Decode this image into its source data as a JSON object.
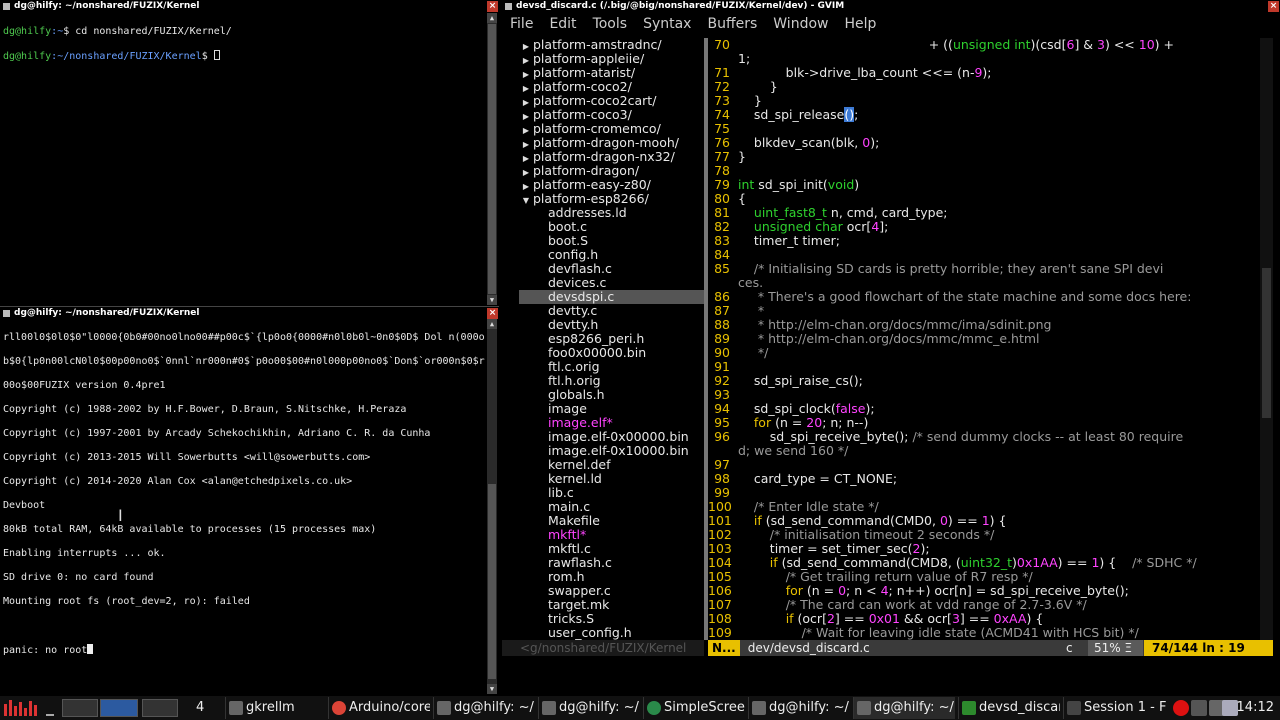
{
  "term1": {
    "title": "dg@hilfy: ~/nonshared/FUZIX/Kernel",
    "lines": [
      {
        "user": "dg@hilfy",
        "path": ":~",
        "cmd": "$ cd nonshared/FUZIX/Kernel/"
      },
      {
        "user": "dg@hilfy",
        "path": ":~/nonshared/FUZIX/Kernel",
        "cmd": "$ "
      }
    ]
  },
  "term2": {
    "title": "dg@hilfy: ~/nonshared/FUZIX/Kernel",
    "lines": [
      "rll00l0$0l0$0\"l0000{0b0#00no0lno00##p00c$`{lp0o0{0000#n0l0b0l~0n0$0D$ Dol n(000o",
      "b$0{lp0n00lcN0l0$00p00no0$`0nnl`nr000n#0$`p0o00$00#n0l000p00no0$`Don$`or000n$0$r",
      "00o$00FUZIX version 0.4pre1",
      "Copyright (c) 1988-2002 by H.F.Bower, D.Braun, S.Nitschke, H.Peraza",
      "Copyright (c) 1997-2001 by Arcady Schekochikhin, Adriano C. R. da Cunha",
      "Copyright (c) 2013-2015 Will Sowerbutts <will@sowerbutts.com>",
      "Copyright (c) 2014-2020 Alan Cox <alan@etchedpixels.co.uk>",
      "Devboot",
      "80kB total RAM, 64kB available to processes (15 processes max)",
      "Enabling interrupts ... ok.",
      "SD drive 0: no card found",
      "Mounting root fs (root_dev=2, ro): failed",
      "",
      "panic: no root"
    ]
  },
  "gvim": {
    "title": "devsd_discard.c (/.big/@big/nonshared/FUZIX/Kernel/dev) - GVIM",
    "menu": [
      "File",
      "Edit",
      "Tools",
      "Syntax",
      "Buffers",
      "Window",
      "Help"
    ],
    "tree": [
      {
        "kind": "dir",
        "arrow": "▶",
        "name": "platform-amstradnc/"
      },
      {
        "kind": "dir",
        "arrow": "▶",
        "name": "platform-appleiie/"
      },
      {
        "kind": "dir",
        "arrow": "▶",
        "name": "platform-atarist/"
      },
      {
        "kind": "dir",
        "arrow": "▶",
        "name": "platform-coco2/"
      },
      {
        "kind": "dir",
        "arrow": "▶",
        "name": "platform-coco2cart/"
      },
      {
        "kind": "dir",
        "arrow": "▶",
        "name": "platform-coco3/"
      },
      {
        "kind": "dir",
        "arrow": "▶",
        "name": "platform-cromemco/"
      },
      {
        "kind": "dir",
        "arrow": "▶",
        "name": "platform-dragon-mooh/"
      },
      {
        "kind": "dir",
        "arrow": "▶",
        "name": "platform-dragon-nx32/"
      },
      {
        "kind": "dir",
        "arrow": "▶",
        "name": "platform-dragon/"
      },
      {
        "kind": "dir",
        "arrow": "▶",
        "name": "platform-easy-z80/"
      },
      {
        "kind": "dir",
        "arrow": "▼",
        "name": "platform-esp8266/"
      },
      {
        "kind": "file",
        "name": "addresses.ld"
      },
      {
        "kind": "file",
        "name": "boot.c"
      },
      {
        "kind": "file",
        "name": "boot.S"
      },
      {
        "kind": "file",
        "name": "config.h"
      },
      {
        "kind": "file",
        "name": "devflash.c"
      },
      {
        "kind": "file",
        "name": "devices.c"
      },
      {
        "kind": "file",
        "name": "devsdspi.c",
        "sel": true
      },
      {
        "kind": "file",
        "name": "devtty.c"
      },
      {
        "kind": "file",
        "name": "devtty.h"
      },
      {
        "kind": "file",
        "name": "esp8266_peri.h"
      },
      {
        "kind": "file",
        "name": "foo0x00000.bin"
      },
      {
        "kind": "file",
        "name": "ftl.c.orig"
      },
      {
        "kind": "file",
        "name": "ftl.h.orig"
      },
      {
        "kind": "file",
        "name": "globals.h"
      },
      {
        "kind": "file",
        "name": "image"
      },
      {
        "kind": "file",
        "name": "image.elf*",
        "exe": true
      },
      {
        "kind": "file",
        "name": "image.elf-0x00000.bin"
      },
      {
        "kind": "file",
        "name": "image.elf-0x10000.bin"
      },
      {
        "kind": "file",
        "name": "kernel.def"
      },
      {
        "kind": "file",
        "name": "kernel.ld"
      },
      {
        "kind": "file",
        "name": "lib.c"
      },
      {
        "kind": "file",
        "name": "main.c"
      },
      {
        "kind": "file",
        "name": "Makefile"
      },
      {
        "kind": "file",
        "name": "mkftl*",
        "exe": true
      },
      {
        "kind": "file",
        "name": "mkftl.c"
      },
      {
        "kind": "file",
        "name": "rawflash.c"
      },
      {
        "kind": "file",
        "name": "rom.h"
      },
      {
        "kind": "file",
        "name": "swapper.c"
      },
      {
        "kind": "file",
        "name": "target.mk"
      },
      {
        "kind": "file",
        "name": "tricks.S"
      },
      {
        "kind": "file",
        "name": "user_config.h"
      }
    ],
    "code": [
      {
        "ln": "70",
        "html": "                                                + ((<span class=\"ty\">unsigned int</span>)(csd[<span class=\"num\">6</span>] & <span class=\"num\">3</span>) << <span class=\"num\">10</span>) +"
      },
      {
        "ln": "",
        "html": "1;"
      },
      {
        "ln": "71",
        "html": "            blk->drive_lba_count <<= (n-<span class=\"num\">9</span>);"
      },
      {
        "ln": "72",
        "html": "        }"
      },
      {
        "ln": "73",
        "html": "    }"
      },
      {
        "ln": "74",
        "html": "    sd_spi_release<span class=\"cur\">()</span>;"
      },
      {
        "ln": "75",
        "html": ""
      },
      {
        "ln": "76",
        "html": "    blkdev_scan(blk, <span class=\"num\">0</span>);"
      },
      {
        "ln": "77",
        "html": "}"
      },
      {
        "ln": "78",
        "html": ""
      },
      {
        "ln": "79",
        "html": "<span class=\"ty\">int</span> sd_spi_init(<span class=\"ty\">void</span>)"
      },
      {
        "ln": "80",
        "html": "{"
      },
      {
        "ln": "81",
        "html": "    <span class=\"ty\">uint_fast8_t</span> n, cmd, card_type;"
      },
      {
        "ln": "82",
        "html": "    <span class=\"ty\">unsigned char</span> ocr[<span class=\"num\">4</span>];"
      },
      {
        "ln": "83",
        "html": "    timer_t timer;"
      },
      {
        "ln": "84",
        "html": ""
      },
      {
        "ln": "85",
        "html": "    <span class=\"cm\">/* Initialising SD cards is pretty horrible; they aren't sane SPI devi</span>"
      },
      {
        "ln": "",
        "html": "<span class=\"cm\">ces.</span>"
      },
      {
        "ln": "86",
        "html": "     <span class=\"cm\">* There's a good flowchart of the state machine and some docs here:</span>"
      },
      {
        "ln": "87",
        "html": "     <span class=\"cm\">*</span>"
      },
      {
        "ln": "88",
        "html": "     <span class=\"cm\">* http://elm-chan.org/docs/mmc/ima/sdinit.png</span>"
      },
      {
        "ln": "89",
        "html": "     <span class=\"cm\">* http://elm-chan.org/docs/mmc/mmc_e.html</span>"
      },
      {
        "ln": "90",
        "html": "     <span class=\"cm\">*/</span>"
      },
      {
        "ln": "91",
        "html": ""
      },
      {
        "ln": "92",
        "html": "    sd_spi_raise_cs();"
      },
      {
        "ln": "93",
        "html": ""
      },
      {
        "ln": "94",
        "html": "    sd_spi_clock(<span class=\"num\">false</span>);"
      },
      {
        "ln": "95",
        "html": "    <span class=\"kw\">for</span> (n = <span class=\"num\">20</span>; n; n--)"
      },
      {
        "ln": "96",
        "html": "        sd_spi_receive_byte(); <span class=\"cm\">/* send dummy clocks -- at least 80 require</span>"
      },
      {
        "ln": "",
        "html": "<span class=\"cm\">d; we send 160 */</span>"
      },
      {
        "ln": "97",
        "html": ""
      },
      {
        "ln": "98",
        "html": "    card_type = CT_NONE;"
      },
      {
        "ln": "99",
        "html": ""
      },
      {
        "ln": "100",
        "html": "    <span class=\"cm\">/* Enter Idle state */</span>"
      },
      {
        "ln": "101",
        "html": "    <span class=\"kw\">if</span> (sd_send_command(CMD0, <span class=\"num\">0</span>) == <span class=\"num\">1</span>) {"
      },
      {
        "ln": "102",
        "html": "        <span class=\"cm\">/* initialisation timeout 2 seconds */</span>"
      },
      {
        "ln": "103",
        "html": "        timer = set_timer_sec(<span class=\"num\">2</span>);"
      },
      {
        "ln": "104",
        "html": "        <span class=\"kw\">if</span> (sd_send_command(CMD8, (<span class=\"ty\">uint32_t</span>)<span class=\"num\">0x1AA</span>) == <span class=\"num\">1</span>) {    <span class=\"cm\">/* SDHC */</span>"
      },
      {
        "ln": "105",
        "html": "            <span class=\"cm\">/* Get trailing return value of R7 resp */</span>"
      },
      {
        "ln": "106",
        "html": "            <span class=\"kw\">for</span> (n = <span class=\"num\">0</span>; n < <span class=\"num\">4</span>; n++) ocr[n] = sd_spi_receive_byte();"
      },
      {
        "ln": "107",
        "html": "            <span class=\"cm\">/* The card can work at vdd range of 2.7-3.6V */</span>"
      },
      {
        "ln": "108",
        "html": "            <span class=\"kw\">if</span> (ocr[<span class=\"num\">2</span>] == <span class=\"num\">0x01</span> && ocr[<span class=\"num\">3</span>] == <span class=\"num\">0xAA</span>) {"
      },
      {
        "ln": "109",
        "html": "                <span class=\"cm\">/* Wait for leaving idle state (ACMD41 with HCS bit) */</span>"
      }
    ],
    "status_left": "<g/nonshared/FUZIX/Kernel",
    "status_mode": "N...",
    "status_file": "dev/devsd_discard.c",
    "status_ft": "c",
    "status_pct": "51%  Ξ",
    "status_pos": "74/144  ln  :  19"
  },
  "taskbar": {
    "workspace_num": "4",
    "tasks": [
      {
        "label": "gkrellm"
      },
      {
        "label": "Arduino/core"
      },
      {
        "label": "dg@hilfy: ~/"
      },
      {
        "label": "dg@hilfy: ~/"
      },
      {
        "label": "SimpleScree"
      },
      {
        "label": "dg@hilfy: ~/"
      },
      {
        "label": "dg@hilfy: ~/"
      },
      {
        "label": "devsd_discar"
      },
      {
        "label": "Session 1 - F"
      }
    ],
    "clock": "14:12"
  }
}
